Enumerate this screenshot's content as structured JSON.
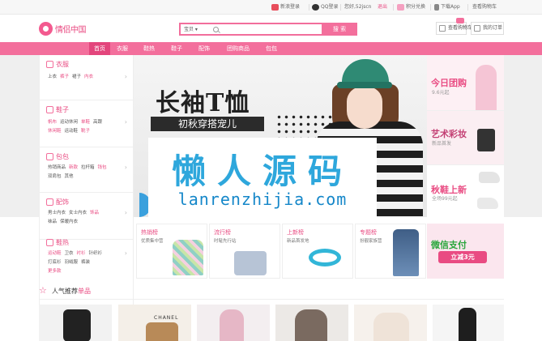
{
  "topbar": {
    "weibo": "新浪登录",
    "qq": "QQ登录",
    "user": "您好,52jscn",
    "logout": "退出",
    "points": "积分兑换",
    "app": "下载App",
    "cart": "查看购物车"
  },
  "header": {
    "logo": "情侣中国",
    "search_category": "宝贝 ▾",
    "search_placeholder": "",
    "search_button": "搜 索",
    "cart_button": "查看购物车",
    "orders_button": "我的订单"
  },
  "nav": {
    "items": [
      "首页",
      "衣服",
      "鞋热",
      "鞋子",
      "配饰",
      "团购商品",
      "包包"
    ]
  },
  "sidebar": {
    "categories": [
      {
        "title": "衣服",
        "rows": [
          [
            "上衣",
            "裤子",
            "裙子",
            "内衣"
          ]
        ],
        "pink": [
          1,
          3
        ]
      },
      {
        "title": "鞋子",
        "rows": [
          [
            "帆布",
            "运动休闲",
            "单鞋",
            "高跟"
          ],
          [
            "休闲鞋",
            "运动鞋",
            "靴子"
          ]
        ],
        "pink": [
          0,
          2
        ]
      },
      {
        "title": "包包",
        "rows": [
          [
            "热销商品",
            "新款",
            "拉杆箱",
            "钱包"
          ],
          [
            "双肩包",
            "其他"
          ]
        ],
        "pink": [
          1,
          3
        ]
      },
      {
        "title": "配饰",
        "rows": [
          [
            "男士内衣",
            "女士内衣",
            "饰品"
          ],
          [
            "袜品",
            "保暖内衣"
          ]
        ],
        "pink": [
          2
        ]
      },
      {
        "title": "鞋热",
        "rows": [
          [
            "运动鞋",
            "卫衣",
            "衬衫",
            "针织衫"
          ],
          [
            "打底衫",
            "羽绒服",
            "裤装"
          ],
          [
            "更多款"
          ]
        ],
        "pink": [
          0,
          2
        ]
      }
    ]
  },
  "banner": {
    "title": "长袖T恤",
    "subtitle": "初秋穿搭宠儿"
  },
  "watermark": {
    "cn": "懒人源码",
    "url": "lanrenzhijia.com"
  },
  "promos": [
    {
      "title": "今日团购",
      "sub": "9.6元起"
    },
    {
      "title": "艺术彩妆",
      "sub": "新品首发"
    },
    {
      "title": "秋鞋上新",
      "sub": "全场99元起"
    },
    {
      "title": "微信支付",
      "sub": "立减3元"
    }
  ],
  "ranks": [
    {
      "title": "热销榜",
      "sub": "优质集中营"
    },
    {
      "title": "流行榜",
      "sub": "时髦先行站"
    },
    {
      "title": "上新榜",
      "sub": "新品首发地"
    },
    {
      "title": "专题榜",
      "sub": "扮靓家族营"
    }
  ],
  "popular": {
    "title_a": "人气推荐",
    "title_b": "单品",
    "brand": "CHANEL"
  },
  "colors": {
    "accent": "#f36f9c",
    "accent_dark": "#e3457c",
    "watermark": "#2ea7dc"
  }
}
